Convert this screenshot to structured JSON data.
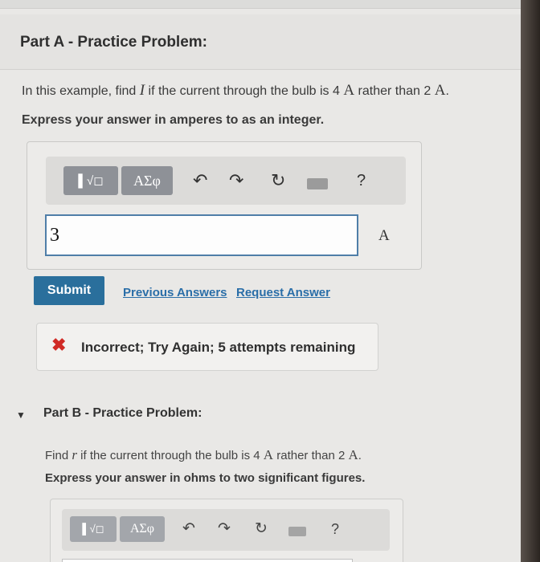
{
  "part_a": {
    "title": "Part A - Practice Problem:",
    "prompt": {
      "pre": "In this example, find ",
      "var": "I",
      "mid": " if the current through the bulb is ",
      "v1": "4",
      "u1": "A",
      "mid2": " rather than ",
      "v2": "2",
      "u2": "A",
      "end": "."
    },
    "instruction": "Express your answer in amperes to as an integer.",
    "toolbar": {
      "templates_label": "▌√◻",
      "greek_label": "ΑΣφ",
      "undo": "↶",
      "redo": "↷",
      "reset": "↻",
      "help": "?"
    },
    "answer_value": "3",
    "unit": "A",
    "submit_label": "Submit",
    "previous_answers_label": "Previous Answers",
    "request_answer_label": "Request Answer",
    "feedback": {
      "icon": "✖",
      "message": "Incorrect; Try Again; 5 attempts remaining"
    }
  },
  "part_b": {
    "title": "Part B - Practice Problem:",
    "prompt": {
      "pre": "Find ",
      "var": "r",
      "mid": " if the current through the bulb is ",
      "v1": "4",
      "u1": "A",
      "mid2": " rather than ",
      "v2": "2",
      "u2": "A",
      "end": "."
    },
    "instruction": "Express your answer in ohms to two significant figures.",
    "toolbar": {
      "templates_label": "▌√◻",
      "greek_label": "ΑΣφ",
      "undo": "↶",
      "redo": "↷",
      "reset": "↻",
      "help": "?"
    }
  },
  "colors": {
    "submit_bg": "#2a6f9c",
    "link": "#2a6ea8",
    "error_x": "#d02a25",
    "input_border": "#4f7ea8"
  }
}
